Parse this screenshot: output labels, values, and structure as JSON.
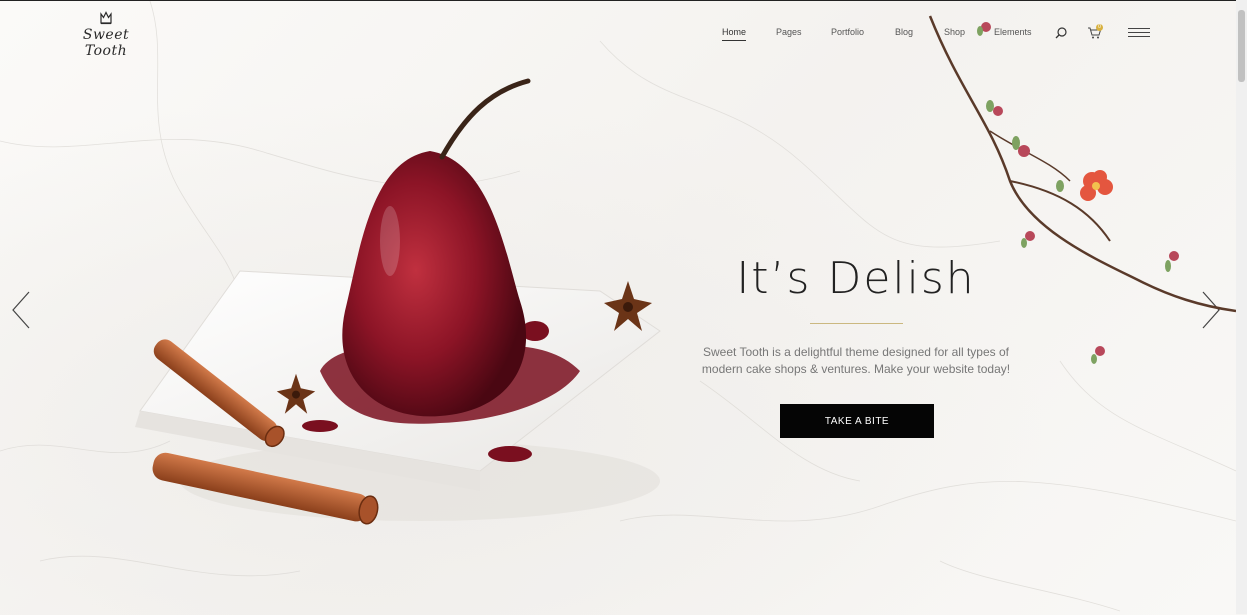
{
  "brand": {
    "logo_text": "Sweet Tooth",
    "icon": "crown-icon"
  },
  "nav": {
    "items": [
      {
        "label": "Home",
        "active": true
      },
      {
        "label": "Pages",
        "active": false
      },
      {
        "label": "Portfolio",
        "active": false
      },
      {
        "label": "Blog",
        "active": false
      },
      {
        "label": "Shop",
        "active": false
      },
      {
        "label": "Elements",
        "active": false
      }
    ],
    "icons": [
      "search-icon",
      "cart-icon",
      "menu-icon"
    ],
    "cart_count": "0"
  },
  "hero": {
    "headline": "It’s Delish",
    "description": "Sweet Tooth is a delightful theme designed for all types of modern cake shops & ventures. Make your website today!",
    "cta_label": "TAKE A BITE",
    "prev_icon": "chevron-left-icon",
    "next_icon": "chevron-right-icon"
  },
  "colors": {
    "accent": "#cbb880",
    "button_bg": "#050505",
    "cart_badge": "#d8b13f",
    "pear": "#8c1426"
  }
}
